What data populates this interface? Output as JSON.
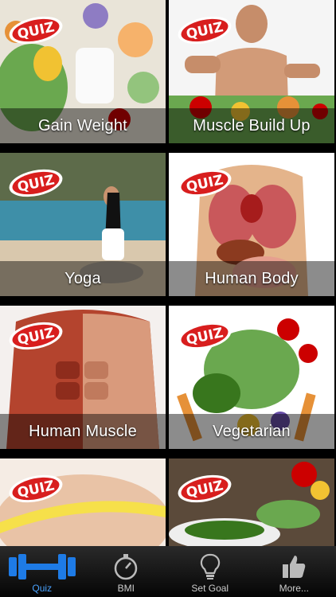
{
  "tiles": [
    {
      "label": "Gain Weight",
      "badge": "QUIZ"
    },
    {
      "label": "Muscle Build Up",
      "badge": "QUIZ"
    },
    {
      "label": "Yoga",
      "badge": "QUIZ"
    },
    {
      "label": "Human Body",
      "badge": "QUIZ"
    },
    {
      "label": "Human Muscle",
      "badge": "QUIZ"
    },
    {
      "label": "Vegetarian",
      "badge": "QUIZ"
    },
    {
      "label": "",
      "badge": "QUIZ"
    },
    {
      "label": "",
      "badge": "QUIZ"
    }
  ],
  "tabbar": {
    "tabs": [
      {
        "label": "Quiz",
        "icon": "dumbbell-icon",
        "active": true
      },
      {
        "label": "BMI",
        "icon": "stopwatch-icon",
        "active": false
      },
      {
        "label": "Set Goal",
        "icon": "lightbulb-icon",
        "active": false
      },
      {
        "label": "More...",
        "icon": "thumbs-up-icon",
        "active": false
      }
    ]
  },
  "colors": {
    "active_tab": "#4aa3ff",
    "inactive_tab": "#cccccc",
    "badge_red": "#d81e1e"
  }
}
